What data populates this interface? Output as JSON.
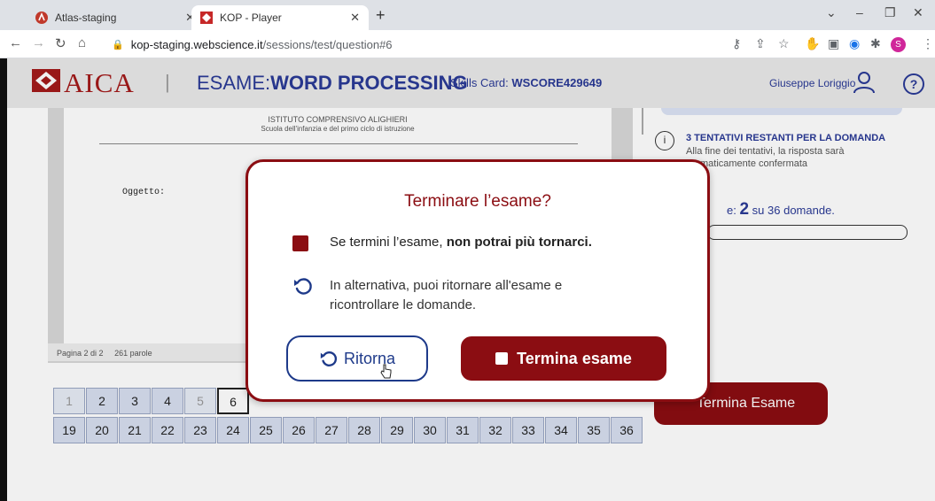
{
  "browser": {
    "tabs": [
      {
        "title": "Atlas-staging",
        "active": false
      },
      {
        "title": "KOP - Player",
        "active": true
      }
    ],
    "url_host": "kop-staging.webscience.it",
    "url_path": "/sessions/test/question#6",
    "profile_initial": "S"
  },
  "header": {
    "logo_text": "AICA",
    "separator": "|",
    "exam_label": "ESAME:",
    "exam_name": "WORD PROCESSING",
    "skills_label": "Skills Card:",
    "skills_code": "WSCORE429649",
    "user_name": "Giuseppe Loriggio",
    "help_label": "?"
  },
  "document": {
    "school_name": "ISTITUTO COMPRENSIVO ALIGHIERI",
    "school_sub": "Scuola dell'infanzia e del primo ciclo di istruzione",
    "subject_label": "Oggetto:",
    "page_info": "Pagina 2 di 2",
    "word_count": "261 parole"
  },
  "question_grid": {
    "row1": [
      "1",
      "2",
      "3",
      "4",
      "5",
      "6"
    ],
    "row2": [
      "19",
      "20",
      "21",
      "22",
      "23",
      "24",
      "25",
      "26",
      "27",
      "28",
      "29",
      "30",
      "31",
      "32",
      "33",
      "34",
      "35",
      "36"
    ],
    "current": "6"
  },
  "side_panel": {
    "attempts_title": "3 TENTATIVI RESTANTI PER LA DOMANDA",
    "attempts_line1": "Alla fine dei tentativi, la risposta sarà",
    "attempts_line2": "maticamente confermata",
    "progress_prefix": "e:",
    "progress_value": "2",
    "progress_suffix": "su 36 domande.",
    "terminate_label": "Termina Esame"
  },
  "modal": {
    "title": "Terminare l’esame?",
    "warning_prefix": "Se termini l’esame,",
    "warning_bold": "non potrai più tornarci.",
    "alternative_line1": "In alternativa, puoi ritornare all'esame e",
    "alternative_line2": "ricontrollare le domande.",
    "return_label": "Ritorna",
    "terminate_label": "Termina esame"
  },
  "colors": {
    "brand_red": "#8b0d12",
    "brand_blue": "#2a3a96"
  }
}
